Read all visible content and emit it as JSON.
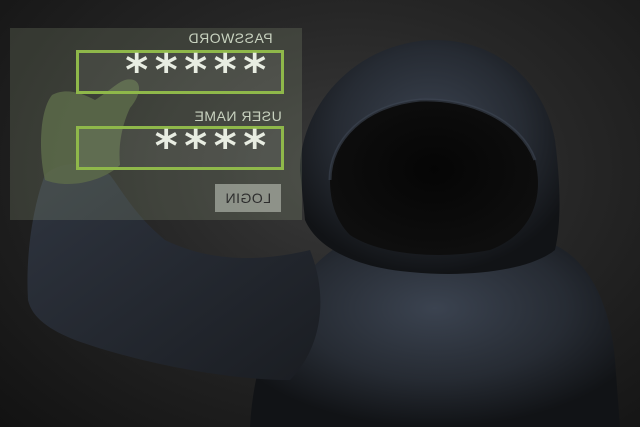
{
  "login_panel": {
    "password_label": "PASSWORD",
    "password_value": "*****",
    "username_label": "USER NAME",
    "username_value": "****",
    "login_button": "LOGIN"
  },
  "colors": {
    "field_border": "#8fb84a",
    "panel_tint": "#96a582"
  }
}
